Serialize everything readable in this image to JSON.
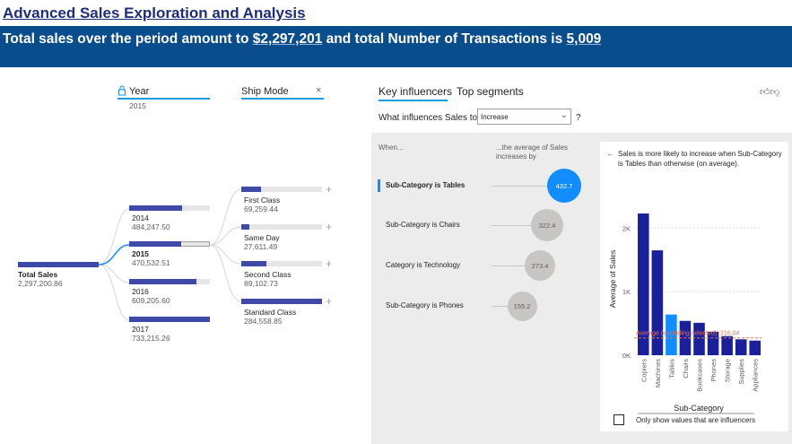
{
  "page": {
    "title": "Advanced Sales Exploration and Analysis ",
    "banner_prefix": "Total sales over the period amount to ",
    "banner_sales": "$2,297,201",
    "banner_mid": " and total Number of Transactions is ",
    "banner_count": "5,009"
  },
  "decomp_tree": {
    "year_header": "Year",
    "year_sub": "2015",
    "shipmode_header": "Ship Mode",
    "close_icon": "×",
    "root": {
      "label": "Total Sales",
      "value": "2,297,200.86",
      "fraction": 1.0
    },
    "years": [
      {
        "label": "2014",
        "value": "484,247.50",
        "fraction": 0.66,
        "selected": false
      },
      {
        "label": "2015",
        "value": "470,532.51",
        "fraction": 0.64,
        "selected": true
      },
      {
        "label": "2016",
        "value": "609,205.60",
        "fraction": 0.83,
        "selected": false
      },
      {
        "label": "2017",
        "value": "733,215.26",
        "fraction": 1.0,
        "selected": false
      }
    ],
    "ship_modes": [
      {
        "label": "First Class",
        "value": "69,259.44",
        "fraction": 0.24
      },
      {
        "label": "Same Day",
        "value": "27,611.49",
        "fraction": 0.1
      },
      {
        "label": "Second Class",
        "value": "89,102.73",
        "fraction": 0.31
      },
      {
        "label": "Standard Class",
        "value": "284,558.85",
        "fraction": 1.0
      }
    ],
    "plus": "+"
  },
  "key_influencers": {
    "tab_active": "Key influencers",
    "tab_other": "Top segments",
    "question": "What influences Sales to",
    "select_value": "Increase",
    "help": "?",
    "col_when": "When...",
    "col_avg": "...the average of Sales increases by",
    "influencers": [
      {
        "label": "Sub-Category is Tables",
        "value": "432.7",
        "selected": true
      },
      {
        "label": "Sub-Category is Chairs",
        "value": "322.4",
        "selected": false
      },
      {
        "label": "Category is Technology",
        "value": "273.4",
        "selected": false
      },
      {
        "label": "Sub-Category is Phones",
        "value": "155.2",
        "selected": false
      }
    ],
    "detail_text": "Sales is more likely to increase when Sub-Category is Tables than otherwise (on average).",
    "checkbox_label": "Only show values that are influencers",
    "icons": [
      "thumbs-up-icon",
      "thumbs-down-icon"
    ]
  },
  "chart_data": {
    "type": "bar",
    "categories": [
      "Copiers",
      "Machines",
      "Tables",
      "Chairs",
      "Bookcases",
      "Phones",
      "Storage",
      "Supplies",
      "Appliances"
    ],
    "values": [
      2230,
      1650,
      640,
      540,
      510,
      370,
      300,
      250,
      230
    ],
    "highlight": "Tables",
    "bar_color": "#1a1f9c",
    "highlight_color": "#118dff",
    "average_line": {
      "value": 216.04,
      "label": "Average (excluding selected): 216.04",
      "color": "#e8704a"
    },
    "xlabel": "Sub-Category",
    "ylabel": "Average of Sales",
    "yticks": [
      "0K",
      "1K",
      "2K"
    ],
    "ylim": [
      0,
      2400
    ]
  }
}
